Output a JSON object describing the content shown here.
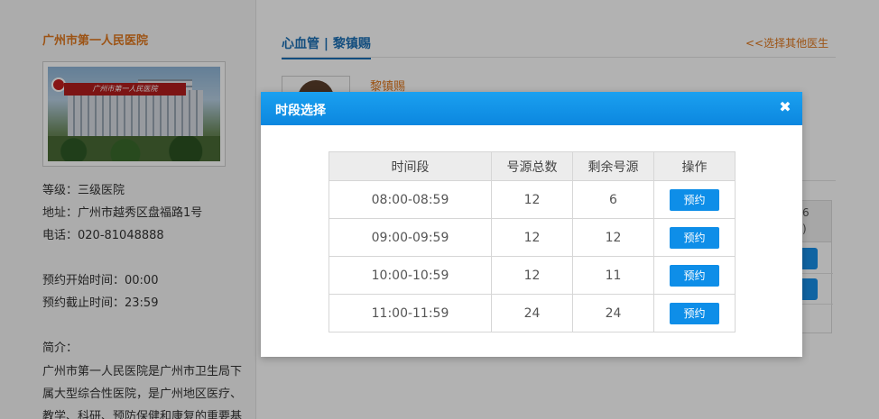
{
  "hospital": {
    "name": "广州市第一人民医院",
    "photo_banner": "广州市第一人民医院",
    "level": "等级：三级医院",
    "address": "地址：广州市越秀区盘福路1号",
    "phone": "电话：020-81048888",
    "booking_start": "预约开始时间：00:00",
    "booking_end": "预约截止时间：23:59",
    "intro_label": "简介：",
    "intro_text": "广州市第一人民医院是广州市卫生局下属大型综合性医院，是广州地区医疗、教学、科研、预防保健和康复的重要基"
  },
  "doctor": {
    "header_title": "心血管 | 黎镇赐",
    "name": "黎镇赐",
    "other_doctor_link": "<<选择其他医生"
  },
  "background_table": {
    "header_partial": "6",
    "header_partial2": ")"
  },
  "modal": {
    "title": "时段选择",
    "close_icon": "close-icon",
    "columns": [
      "时间段",
      "号源总数",
      "剩余号源",
      "操作"
    ],
    "rows": [
      {
        "time": "08:00-08:59",
        "total": "12",
        "remaining": "6",
        "action": "预约"
      },
      {
        "time": "09:00-09:59",
        "total": "12",
        "remaining": "12",
        "action": "预约"
      },
      {
        "time": "10:00-10:59",
        "total": "12",
        "remaining": "11",
        "action": "预约"
      },
      {
        "time": "11:00-11:59",
        "total": "24",
        "remaining": "24",
        "action": "预约"
      }
    ]
  },
  "colors": {
    "accent_blue": "#0e8ee8",
    "header_orange": "#e0781e",
    "overlay": "rgba(0,0,0,0.3)"
  }
}
